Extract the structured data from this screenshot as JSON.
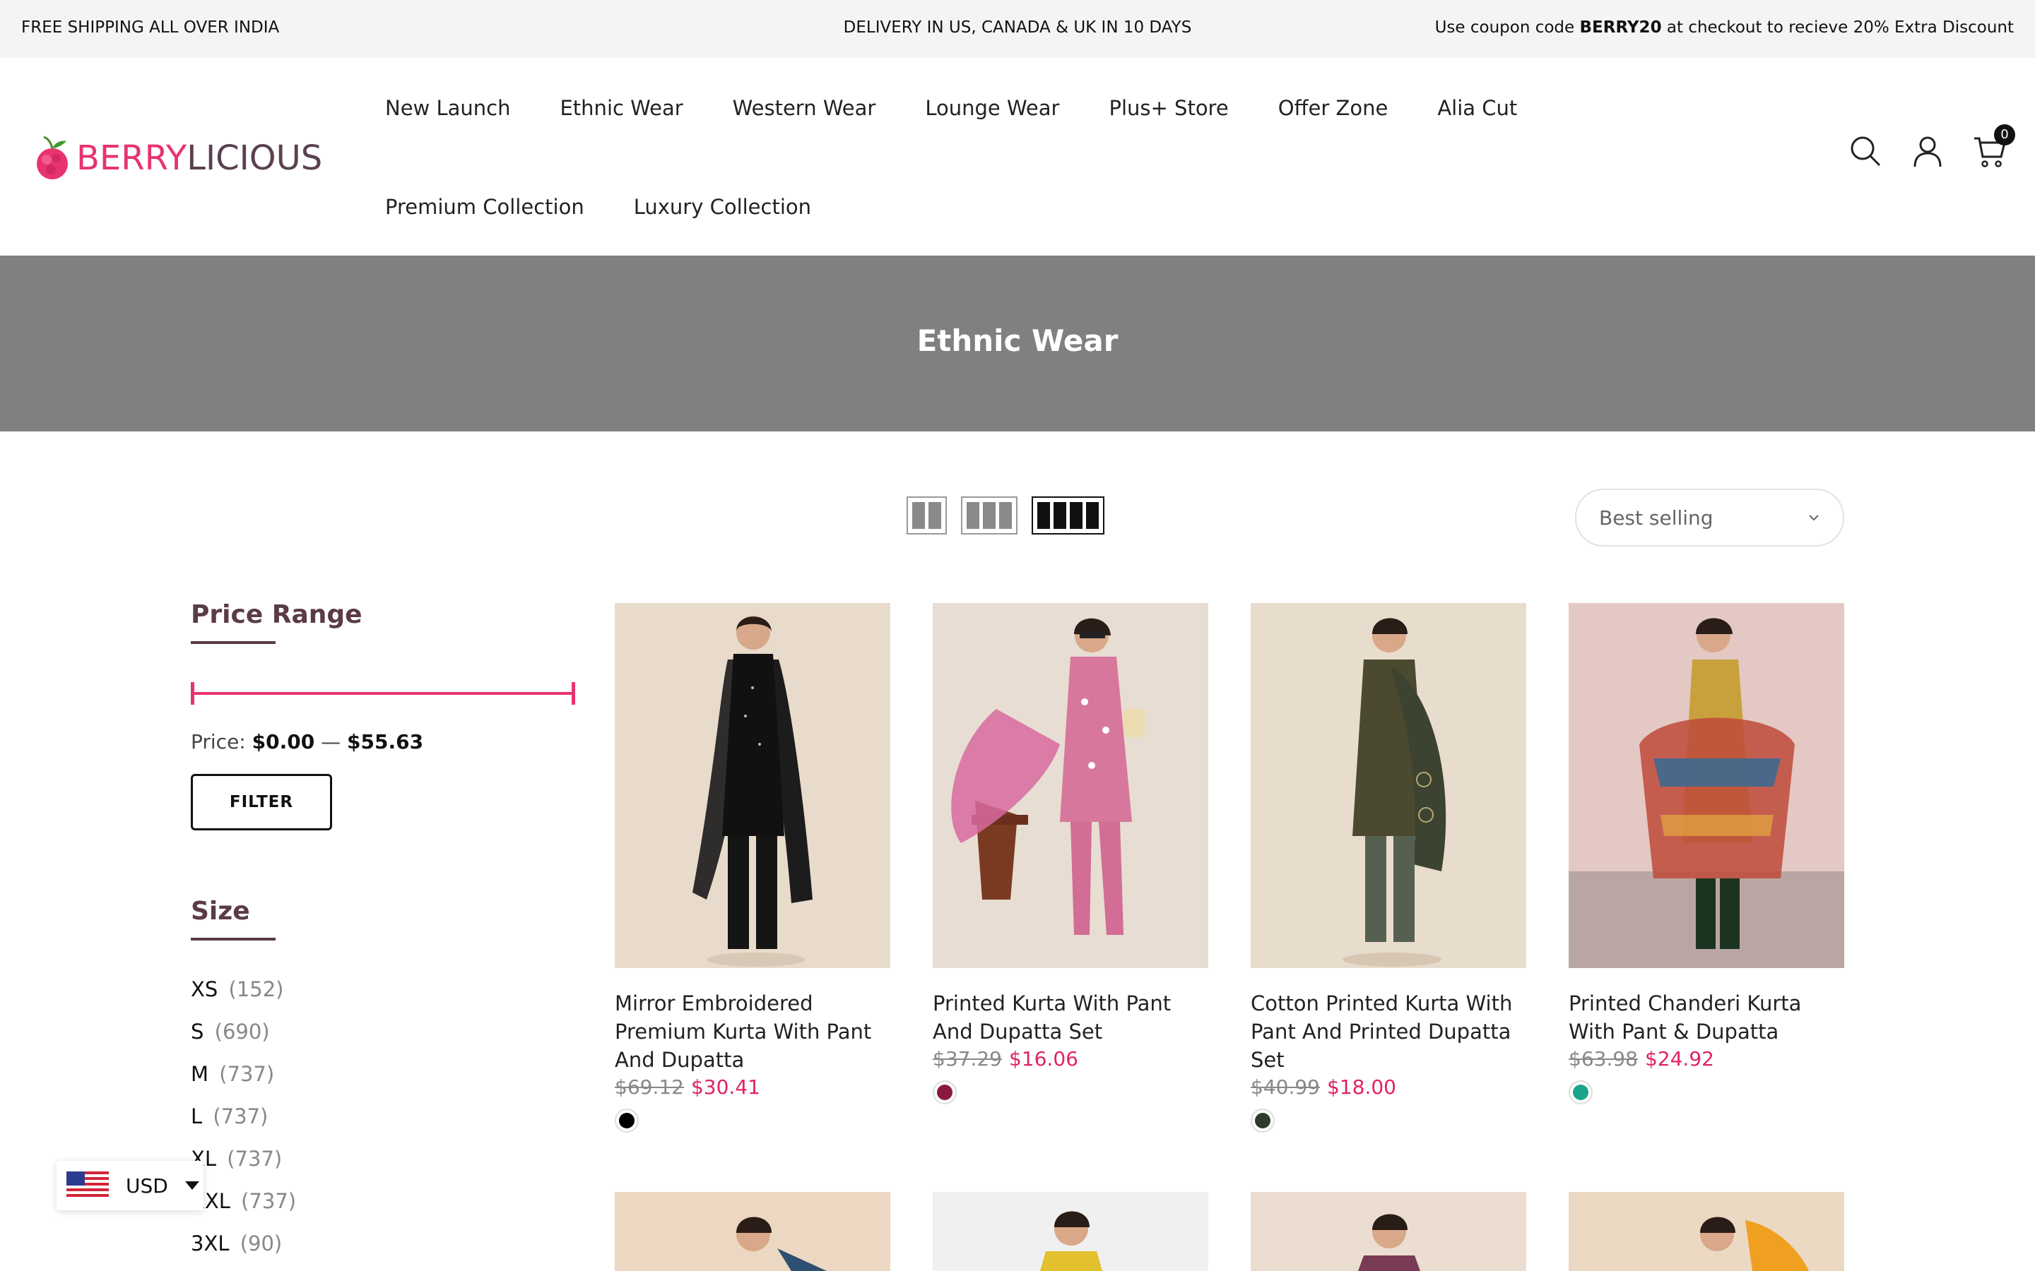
{
  "announcement": {
    "left": "FREE SHIPPING ALL OVER INDIA",
    "center": "DELIVERY IN US, CANADA & UK IN 10 DAYS",
    "right_prefix": "Use coupon code",
    "right_code": "BERRY20",
    "right_suffix": "at checkout to recieve 20% Extra Discount"
  },
  "brand": {
    "part1": "BERRY",
    "part2": "LICIOUS",
    "pink": "#e8336f",
    "plum": "#5a4150"
  },
  "nav": {
    "row1": [
      "New Launch",
      "Ethnic Wear",
      "Western Wear",
      "Lounge Wear",
      "Plus+ Store",
      "Offer Zone",
      "Alia Cut"
    ],
    "row2": [
      "Premium Collection",
      "Luxury Collection"
    ]
  },
  "header_icons": {
    "search": "search-icon",
    "account": "user-icon",
    "cart": "cart-icon",
    "cart_count": "0"
  },
  "banner": {
    "title": "Ethnic Wear",
    "bg": "#808080"
  },
  "toolbar": {
    "sort_selected": "Best selling",
    "active_view": 3
  },
  "sidebar": {
    "price_heading": "Price Range",
    "price_label": "Price:",
    "price_min": "$0.00",
    "price_sep": "—",
    "price_max": "$55.63",
    "filter_label": "FILTER",
    "size_heading": "Size",
    "sizes": [
      {
        "label": "XS",
        "count": "(152)"
      },
      {
        "label": "S",
        "count": "(690)"
      },
      {
        "label": "M",
        "count": "(737)"
      },
      {
        "label": "L",
        "count": "(737)"
      },
      {
        "label": "XL",
        "count": "(737)"
      },
      {
        "label": "XXL",
        "count": "(737)"
      },
      {
        "label": "3XL",
        "count": "(90)"
      }
    ]
  },
  "products": [
    {
      "title": "Mirror Embroidered Premium Kurta With Pant And Dupatta",
      "old": "$69.12",
      "new": "$30.41",
      "swatch": "#000000"
    },
    {
      "title": "Printed Kurta With Pant And Dupatta Set",
      "old": "$37.29",
      "new": "$16.06",
      "swatch": "#8a1a3c"
    },
    {
      "title": "Cotton Printed Kurta With Pant And Printed Dupatta Set",
      "old": "$40.99",
      "new": "$18.00",
      "swatch": "#2f3a28"
    },
    {
      "title": "Printed Chanderi Kurta With Pant & Dupatta",
      "old": "$63.98",
      "new": "$24.92",
      "swatch": "#1aa58c"
    }
  ],
  "currency": {
    "code": "USD"
  }
}
